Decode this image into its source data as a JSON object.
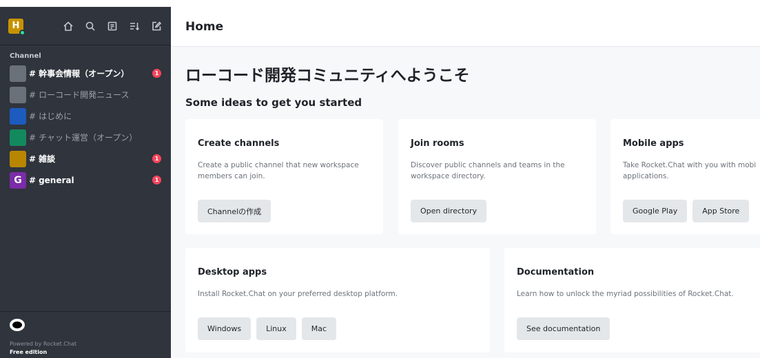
{
  "sidebar": {
    "workspace_initial": "H",
    "section_title": "Channel",
    "rooms": [
      {
        "avatar": "",
        "avatar_color": "#6b717a",
        "name": "幹事会情報（オープン）",
        "unread": true,
        "badge": "1"
      },
      {
        "avatar": "",
        "avatar_color": "#6b717a",
        "name": "ローコード開発ニュース",
        "unread": false,
        "badge": ""
      },
      {
        "avatar": "",
        "avatar_color": "#1d5bbf",
        "name": "はじめに",
        "unread": false,
        "badge": ""
      },
      {
        "avatar": "",
        "avatar_color": "#138a5e",
        "name": "チャット運営（オープン）",
        "unread": false,
        "badge": ""
      },
      {
        "avatar": "",
        "avatar_color": "#b88600",
        "name": "雑談",
        "unread": true,
        "badge": "1"
      },
      {
        "avatar": "G",
        "avatar_color": "#7b2ca8",
        "name": "general",
        "unread": true,
        "badge": "1"
      }
    ],
    "hash": "#",
    "powered_by": "Powered by Rocket.Chat",
    "edition": "Free edition"
  },
  "icons": {
    "home": "home-icon",
    "search": "search-icon",
    "directory": "directory-icon",
    "sort": "sort-icon",
    "compose": "compose-icon"
  },
  "header": {
    "title": "Home"
  },
  "main": {
    "welcome": "ローコード開発コミュニティへようこそ",
    "ideas": "Some ideas to get you started",
    "cards": {
      "create": {
        "title": "Create channels",
        "desc1": "Create a public channel that new workspace",
        "desc2": "members can join.",
        "buttons": [
          "Channelの作成"
        ]
      },
      "join": {
        "title": "Join rooms",
        "desc1": "Discover public channels and teams in the",
        "desc2": "workspace directory.",
        "buttons": [
          "Open directory"
        ]
      },
      "mobile": {
        "title": "Mobile apps",
        "desc1": "Take Rocket.Chat with you with mobi",
        "desc2": "applications.",
        "buttons": [
          "Google Play",
          "App Store"
        ]
      },
      "desktop": {
        "title": "Desktop apps",
        "desc1": "Install Rocket.Chat on your preferred desktop platform.",
        "buttons": [
          "Windows",
          "Linux",
          "Mac"
        ]
      },
      "docs": {
        "title": "Documentation",
        "desc1": "Learn how to unlock the myriad possibilities of Rocket.Chat.",
        "buttons": [
          "See documentation"
        ]
      }
    }
  }
}
